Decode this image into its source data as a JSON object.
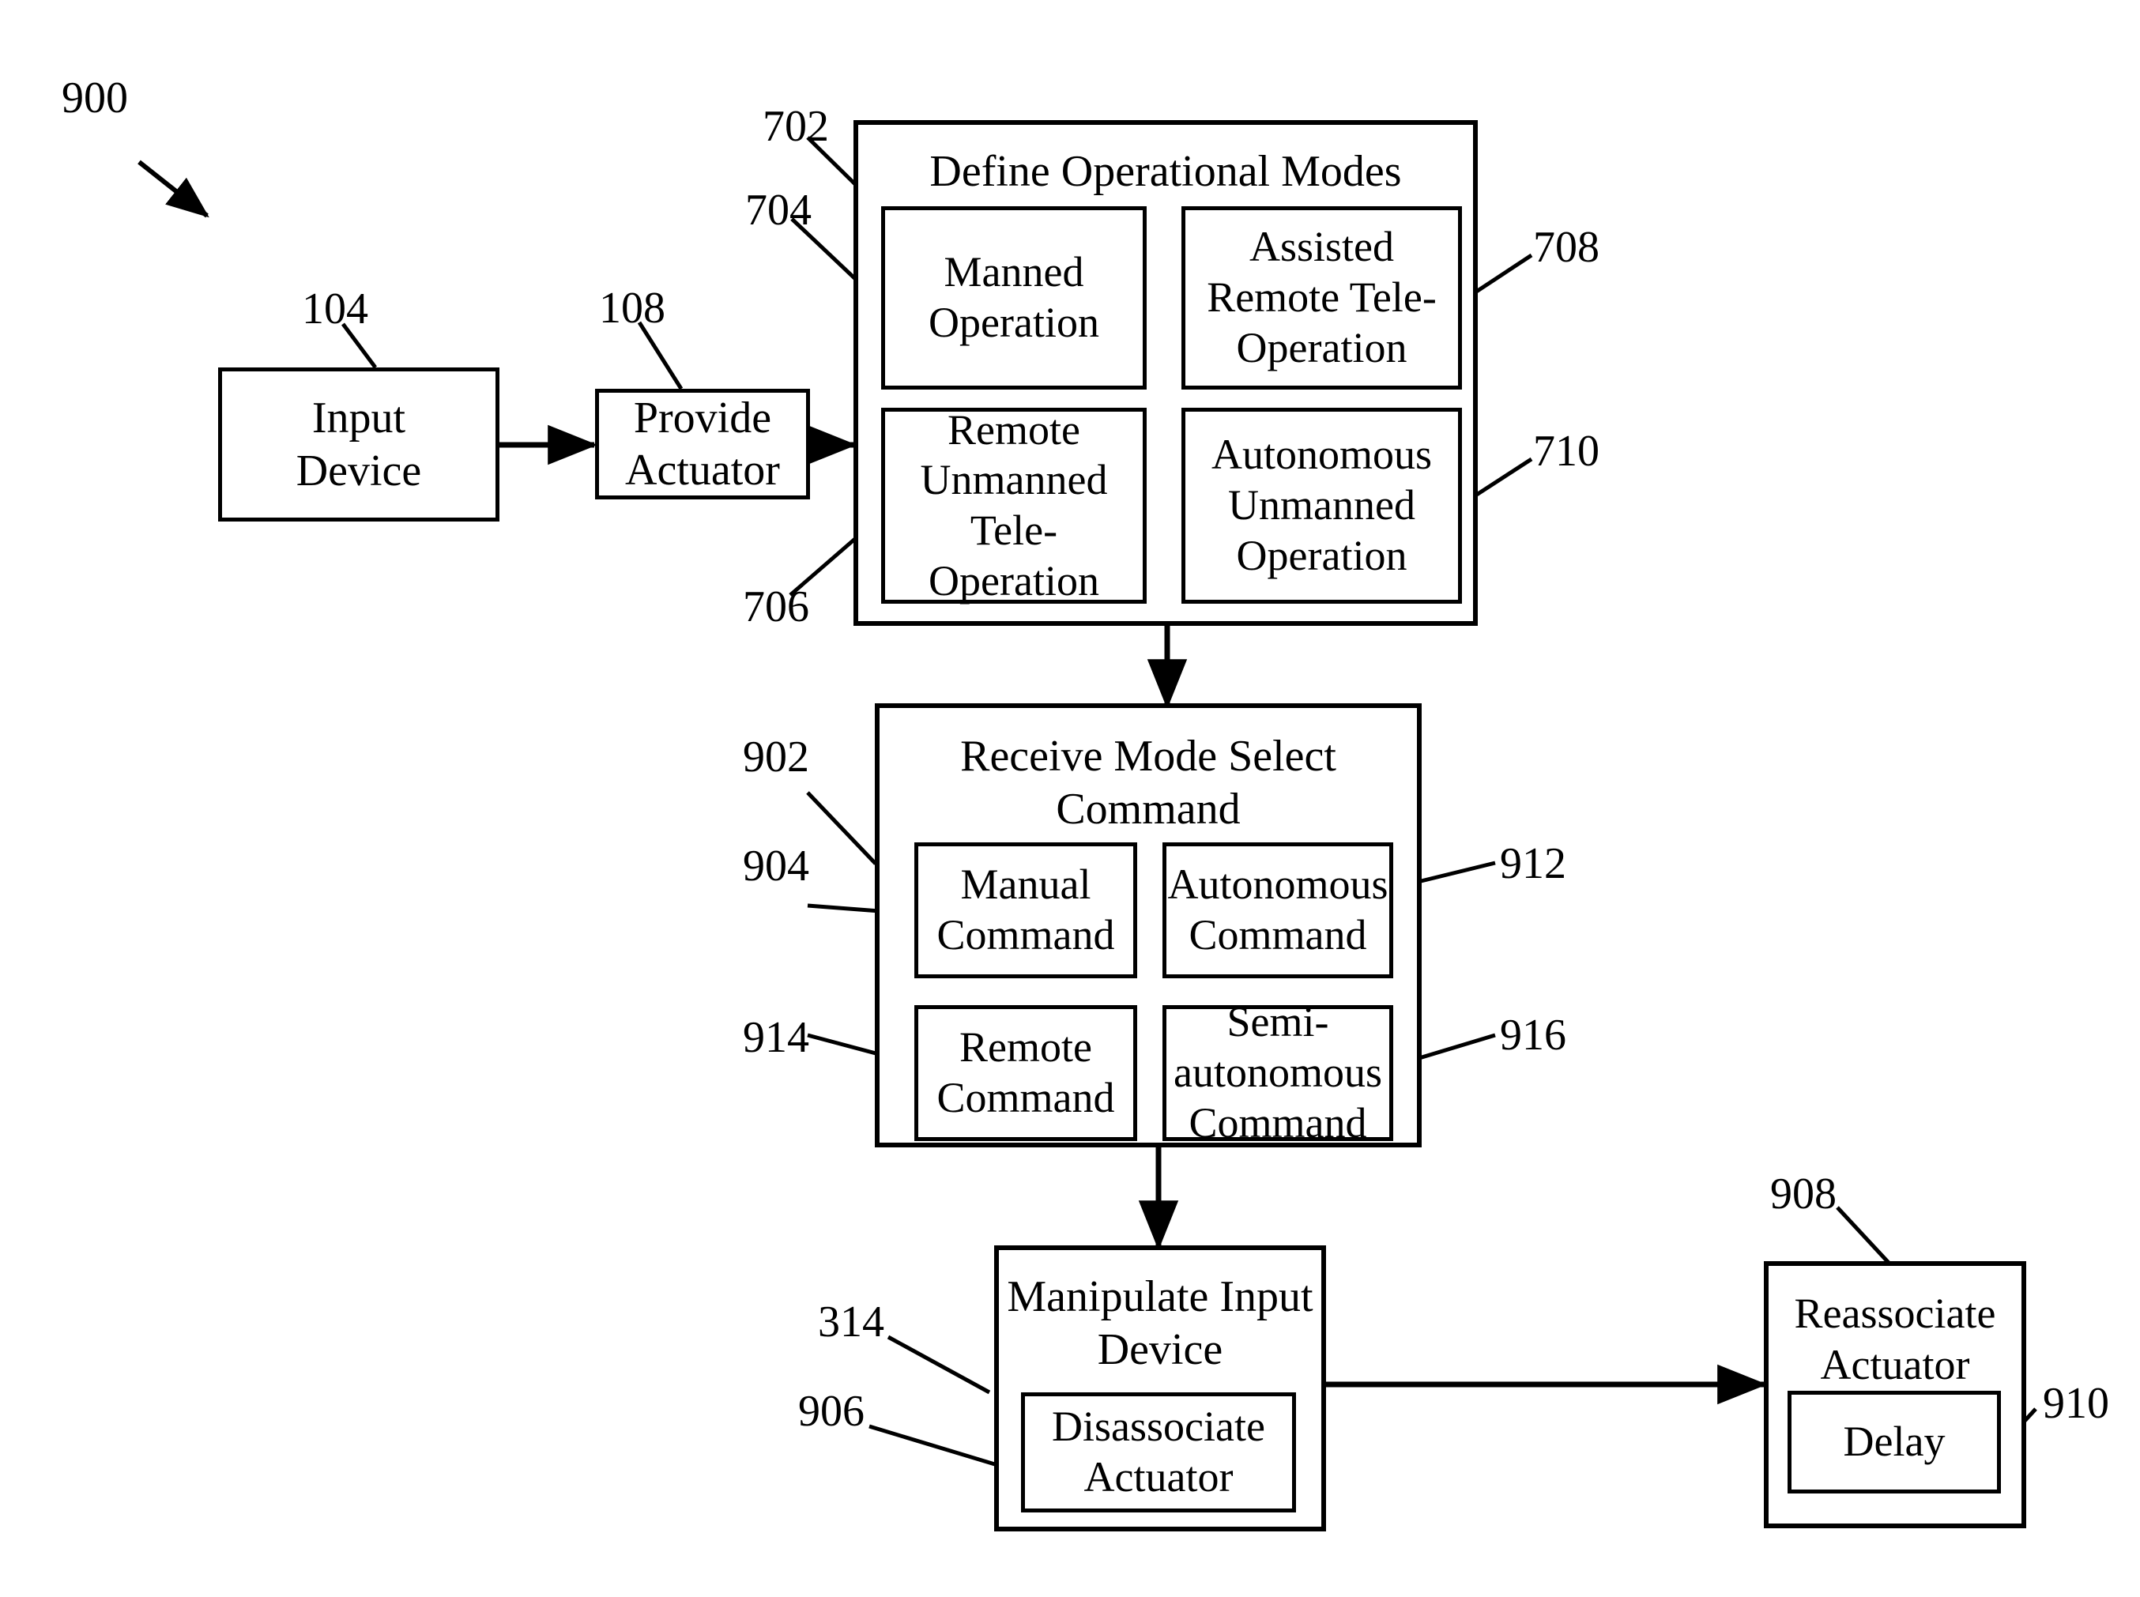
{
  "figure": {
    "id": "900",
    "reference_numerals": {
      "fig_900": "900",
      "input_device": "104",
      "provide_actuator": "108",
      "define_operational_modes": "702",
      "manned_operation": "704",
      "remote_unmanned_tele_operation": "706",
      "assisted_remote_tele_operation": "708",
      "autonomous_unmanned_operation": "710",
      "receive_mode_select_command": "902",
      "manual_command": "904",
      "autonomous_command": "912",
      "remote_command": "914",
      "semi_autonomous_command": "916",
      "manipulate_input_device": "314",
      "disassociate_actuator": "906",
      "reassociate_actuator": "908",
      "delay": "910"
    }
  },
  "blocks": {
    "input_device": {
      "label": "Input\nDevice"
    },
    "provide_actuator": {
      "label": "Provide\nActuator"
    },
    "define_operational_modes": {
      "title": "Define Operational Modes",
      "modes": [
        {
          "label": "Manned\nOperation"
        },
        {
          "label": "Assisted\nRemote Tele-\nOperation"
        },
        {
          "label": "Remote\nUnmanned\nTele-\nOperation"
        },
        {
          "label": "Autonomous\nUnmanned\nOperation"
        }
      ]
    },
    "receive_mode_select_command": {
      "title": "Receive Mode Select\nCommand",
      "commands": [
        {
          "label": "Manual\nCommand"
        },
        {
          "label": "Autonomous\nCommand"
        },
        {
          "label": "Remote\nCommand"
        },
        {
          "label": "Semi-\nautonomous\nCommand"
        }
      ]
    },
    "manipulate_input_device": {
      "title": "Manipulate Input\nDevice",
      "inner": {
        "label": "Disassociate\nActuator"
      }
    },
    "reassociate_actuator": {
      "title": "Reassociate\nActuator",
      "inner": {
        "label": "Delay"
      }
    }
  },
  "colors": {
    "line": "#000000",
    "background": "#ffffff"
  }
}
